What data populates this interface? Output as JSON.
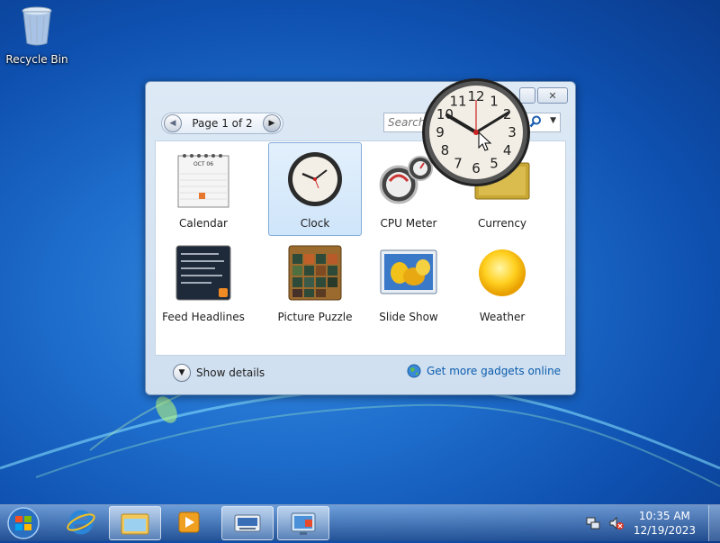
{
  "desktop": {
    "recycle_bin_label": "Recycle Bin"
  },
  "gallery": {
    "pager_text": "Page 1 of 2",
    "search_placeholder": "Search",
    "gadgets": [
      {
        "label": "Calendar",
        "icon": "calendar-icon"
      },
      {
        "label": "Clock",
        "icon": "clock-icon",
        "selected": true
      },
      {
        "label": "CPU Meter",
        "icon": "cpu-meter-icon"
      },
      {
        "label": "Currency",
        "icon": "currency-icon"
      },
      {
        "label": "Feed Headlines",
        "icon": "feed-headlines-icon"
      },
      {
        "label": "Picture Puzzle",
        "icon": "picture-puzzle-icon"
      },
      {
        "label": "Slide Show",
        "icon": "slide-show-icon"
      },
      {
        "label": "Weather",
        "icon": "weather-icon"
      }
    ],
    "calendar_month": "OCT 06",
    "show_details_label": "Show details",
    "get_more_label": "Get more gadgets online"
  },
  "dragged_clock": {
    "numerals": [
      "12",
      "1",
      "2",
      "3",
      "4",
      "5",
      "6",
      "7",
      "8",
      "9",
      "10",
      "11"
    ]
  },
  "taskbar": {
    "time": "10:35 AM",
    "date": "12/19/2023"
  },
  "colors": {
    "accent_link": "#0b5cad",
    "selection": "#cfe5fa",
    "desktop": "#1f6fce"
  }
}
